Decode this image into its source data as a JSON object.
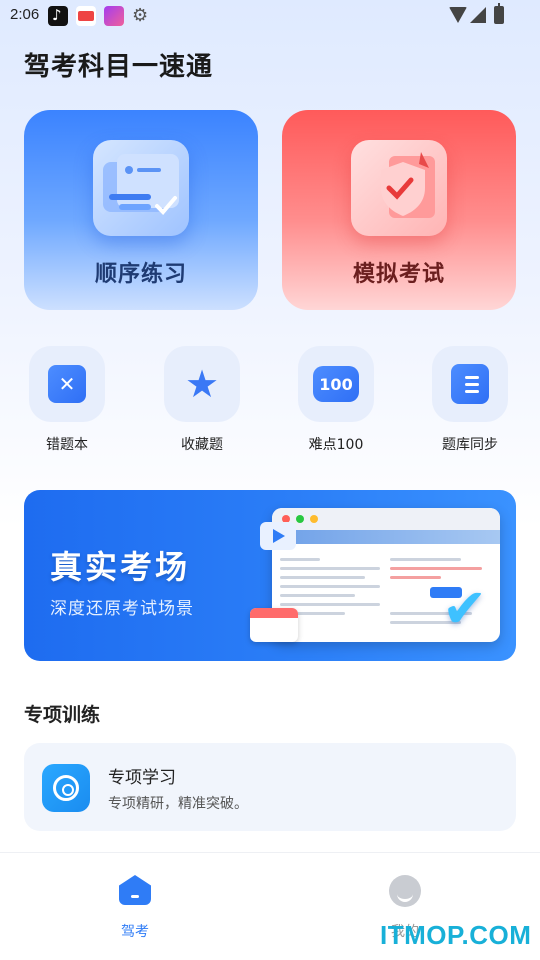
{
  "status_bar": {
    "time": "2:06",
    "apps": [
      "tiktok-icon",
      "app-red-icon",
      "app-purple-icon",
      "settings-icon"
    ],
    "indicators": [
      "wifi-icon",
      "signal-icon",
      "battery-icon"
    ]
  },
  "header": {
    "title": "驾考科目一速通"
  },
  "main_cards": [
    {
      "label": "顺序练习",
      "icon": "checklist-icon",
      "color": "#3b83ff"
    },
    {
      "label": "模拟考试",
      "icon": "shield-check-icon",
      "color": "#ff5a5a"
    }
  ],
  "tools": [
    {
      "label": "错题本",
      "icon": "mistake-book-icon"
    },
    {
      "label": "收藏题",
      "icon": "star-icon"
    },
    {
      "label": "难点100",
      "icon": "hundred-icon",
      "icon_text": "100"
    },
    {
      "label": "题库同步",
      "icon": "sync-doc-icon"
    }
  ],
  "banner": {
    "title": "真实考场",
    "subtitle": "深度还原考试场景"
  },
  "section": {
    "title": "专项训练"
  },
  "special": {
    "title": "专项学习",
    "subtitle": "专项精研，精准突破。",
    "icon": "target-icon"
  },
  "nav": {
    "items": [
      {
        "label": "驾考",
        "icon": "home-icon",
        "active": true
      },
      {
        "label": "我的",
        "icon": "profile-icon",
        "active": false
      }
    ]
  },
  "watermark": "ITMOP.COM",
  "colors": {
    "accent": "#2f7cf6",
    "danger": "#ff5a5a",
    "brand_watermark": "#18b0d8"
  }
}
